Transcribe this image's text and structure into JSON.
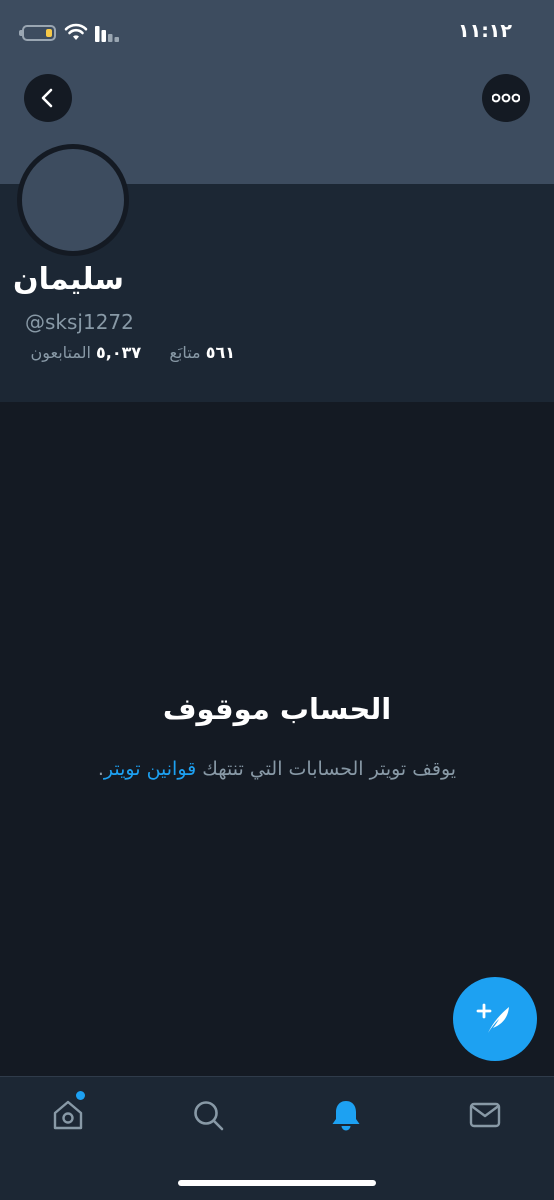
{
  "status_bar": {
    "time": "١١:١٢"
  },
  "profile": {
    "display_name": "سليمان",
    "handle": "@sksj1272",
    "following_count": "٥٦١",
    "following_label": "متابَع",
    "followers_count": "٥,٠٣٧",
    "followers_label": "المتابعون"
  },
  "suspension": {
    "title": "الحساب موقوف",
    "message": "يوقف تويتر الحسابات التي تنتهك",
    "rules_link": "قوانين تويتر",
    "period": "."
  },
  "colors": {
    "background": "#141a23",
    "banner": "#3d4c5f",
    "panel": "#1c2734",
    "accent": "#1da1f2",
    "secondary_text": "#8899a6"
  },
  "icons": {
    "back": "chevron-left-icon",
    "more": "more-dots-icon",
    "compose": "compose-tweet-icon",
    "home": "home-icon",
    "search": "search-icon",
    "notifications": "bell-icon",
    "messages": "mail-icon"
  }
}
